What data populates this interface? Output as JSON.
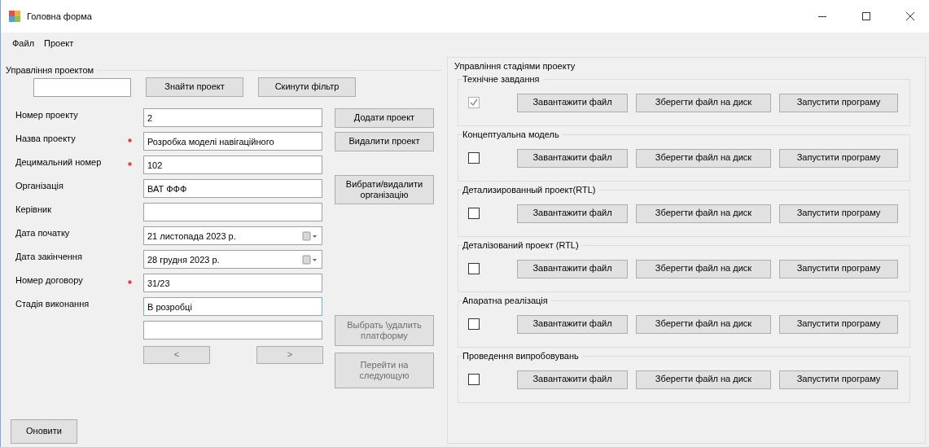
{
  "window": {
    "title": "Головна форма"
  },
  "menu": [
    {
      "label": "Файл"
    },
    {
      "label": "Проект"
    }
  ],
  "project_group": {
    "title": "Управління проектом",
    "search_buttons": [
      {
        "label": "Знайти проект",
        "disabled": false
      },
      {
        "label": "Скинути фільтр",
        "disabled": false
      }
    ],
    "fields": [
      {
        "label": "Номер проекту",
        "required": false,
        "kind": "text",
        "value": "2",
        "focused": false
      },
      {
        "label": "Назва проекту",
        "required": true,
        "kind": "text",
        "value": "Розробка моделі навігаційного",
        "focused": false
      },
      {
        "label": "Децимальний номер",
        "required": true,
        "kind": "text",
        "value": "102",
        "focused": false
      },
      {
        "label": "Організація",
        "required": false,
        "kind": "text",
        "value": "ВАТ  ФФФ",
        "focused": false
      },
      {
        "label": "Керівник",
        "required": false,
        "kind": "text",
        "focused": false
      },
      {
        "label": "Дата початку",
        "required": false,
        "kind": "date",
        "value": "21 листопада 2023 р.",
        "focused": false
      },
      {
        "label": "Дата закінчення",
        "required": false,
        "kind": "date",
        "value": "28 грудня 2023 р.",
        "focused": false
      },
      {
        "label": "Номер договору",
        "required": true,
        "kind": "text",
        "value": "31/23",
        "focused": false
      },
      {
        "label": "Стадія виконання",
        "required": false,
        "kind": "text",
        "value": "В розробці",
        "focused": true
      },
      {
        "required": false,
        "kind": "text",
        "focused": false
      }
    ],
    "nav_buttons": [
      {
        "label": "<",
        "disabled": true
      },
      {
        "label": ">",
        "disabled": true
      }
    ],
    "action_buttons": [
      {
        "label": "Додати проект",
        "disabled": false
      },
      {
        "label": "Видалити проект",
        "disabled": false
      },
      {
        "label": "Вибрати/видалити організацію",
        "disabled": false
      },
      {
        "label": "Выбрать \\удалить платформу",
        "disabled": true
      },
      {
        "label": "Перейти на следующую",
        "disabled": true
      }
    ],
    "refresh_button": {
      "label": "Оновити"
    }
  },
  "stages_group": {
    "title": "Управління стадіями проекту",
    "stages": [
      {
        "title": "Технічне завдання",
        "checked": true,
        "disabled": true,
        "buttons": [
          "Завантажити файл",
          "Зберегти файл на диск",
          "Запустити програму"
        ]
      },
      {
        "title": "Концептуальна модель",
        "checked": false,
        "disabled": false,
        "buttons": [
          "Завантажити файл",
          "Зберегти файл на диск",
          "Запустити програму"
        ]
      },
      {
        "title": "Детализированный проект(RTL)",
        "checked": false,
        "disabled": false,
        "buttons": [
          "Завантажити файл",
          "Зберегти файл на диск",
          "Запустити програму"
        ]
      },
      {
        "title": "Деталізований проект (RTL)",
        "checked": false,
        "disabled": false,
        "buttons": [
          "Завантажити файл",
          "Зберегти файл на диск",
          "Запустити програму"
        ]
      },
      {
        "title": "Апаратна реалізація",
        "checked": false,
        "disabled": false,
        "buttons": [
          "Завантажити файл",
          "Зберегти файл на диск",
          "Запустити програму"
        ]
      },
      {
        "title": "Проведення випробовувань",
        "checked": false,
        "disabled": false,
        "buttons": [
          "Завантажити файл",
          "Зберегти файл на диск",
          "Запустити програму"
        ]
      }
    ]
  }
}
